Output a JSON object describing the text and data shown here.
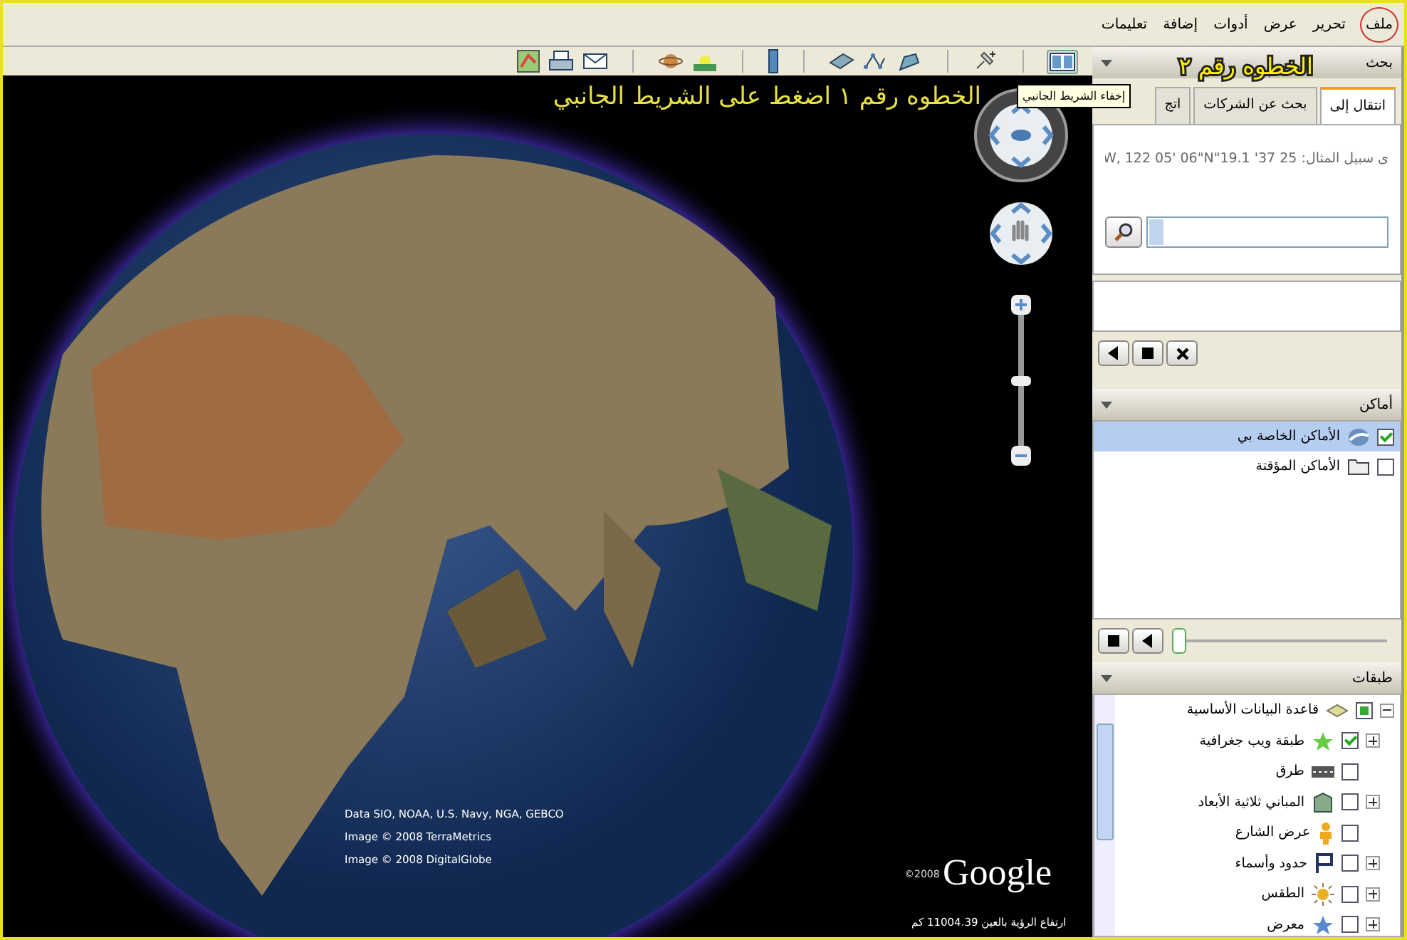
{
  "menu": [
    {
      "label": "ملف",
      "circled": true
    },
    {
      "label": "تحرير",
      "circled": false
    },
    {
      "label": "عرض",
      "circled": false
    },
    {
      "label": "أدوات",
      "circled": false
    },
    {
      "label": "إضافة",
      "circled": false
    },
    {
      "label": "تعليمات",
      "circled": false
    }
  ],
  "toolbar": [
    {
      "kind": "sidebar"
    },
    {
      "kind": "sep"
    },
    {
      "kind": "placemark"
    },
    {
      "kind": "sep"
    },
    {
      "kind": "polygon"
    },
    {
      "kind": "path"
    },
    {
      "kind": "overlay"
    },
    {
      "kind": "sep"
    },
    {
      "kind": "ruler"
    },
    {
      "kind": "sep"
    },
    {
      "kind": "sun"
    },
    {
      "kind": "planet"
    },
    {
      "kind": "sep"
    },
    {
      "kind": "email"
    },
    {
      "kind": "print"
    },
    {
      "kind": "map"
    }
  ],
  "tooltip": "إخفاء الشريط الجانبي",
  "map": {
    "step_note": "الخطوه رقم ١ اضغط على الشريط الجانبي",
    "attribution": [
      "Data SIO, NOAA, U.S. Navy, NGA, GEBCO",
      "Image © 2008 TerraMetrics",
      "Image © 2008 DigitalGlobe"
    ],
    "copyright": "©2008",
    "logo": "Google",
    "altitude": "ارتفاع الرؤية بالعين 11004.39 كم",
    "zoom": {
      "level": 0.5
    }
  },
  "sidebar": {
    "step_note": "الخطوه رقم ٢",
    "search": {
      "header": "بحث",
      "tabs": [
        {
          "label": "انتقال إلى",
          "selected": true
        },
        {
          "label": "بحث عن الشركات",
          "selected": false
        },
        {
          "label": "اتج",
          "selected": false
        }
      ],
      "example": "ى سبيل المثال: 25 37' 19.1\"W, 122 05' 06\"N"
    },
    "places": {
      "header": "أماكن",
      "items": [
        {
          "label": "الأماكن الخاصة بي",
          "checked": true,
          "selected": true,
          "kind": "globe"
        },
        {
          "label": "الأماكن المؤقتة",
          "checked": false,
          "selected": false,
          "kind": "folder"
        }
      ],
      "tour": {
        "level": 0
      }
    },
    "layers": {
      "header": "طبقات",
      "root": {
        "label": "قاعدة البيانات الأساسية",
        "checked": true,
        "expanded": true,
        "children": [
          {
            "label": "طبقة ويب جغرافية",
            "checked": true,
            "expandable": true,
            "kind": "star"
          },
          {
            "label": "طرق",
            "checked": false,
            "expandable": false,
            "kind": "road"
          },
          {
            "label": "المباني ثلاثية الأبعاد",
            "checked": false,
            "expandable": true,
            "kind": "building"
          },
          {
            "label": "عرض الشارع",
            "checked": false,
            "expandable": false,
            "kind": "person"
          },
          {
            "label": "حدود وأسماء",
            "checked": false,
            "expandable": true,
            "kind": "flag"
          },
          {
            "label": "الطقس",
            "checked": false,
            "expandable": true,
            "kind": "sun"
          },
          {
            "label": "معرض",
            "checked": false,
            "expandable": true,
            "kind": "star2"
          }
        ]
      }
    }
  }
}
